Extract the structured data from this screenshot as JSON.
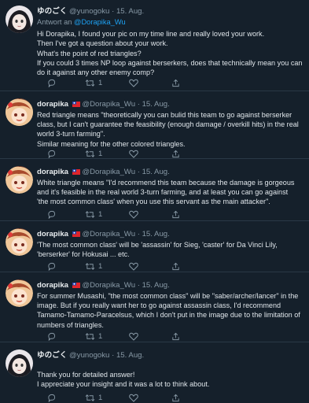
{
  "tweets": [
    {
      "avatar": "avatar-yunogoku",
      "name": "ゆのごく",
      "flag": false,
      "handle": "@yunogoku",
      "sep": "·",
      "date": "15. Aug.",
      "reply_prefix": "Antwort an ",
      "reply_mention": "@Dorapika_Wu",
      "lines": [
        "Hi Dorapika, I found your pic on my time line and really loved your work.",
        "Then I've got a question about your work.",
        "What's the point of red triangles?",
        "If you could 3 times NP loop against berserkers, does that technically mean you can",
        "do it against any other enemy comp?"
      ],
      "retweets": "1"
    },
    {
      "avatar": "avatar-dorapika",
      "name": "dorapika",
      "flag": true,
      "handle": "@Dorapika_Wu",
      "sep": "·",
      "date": "15. Aug.",
      "lines": [
        "Red triangle means \"theoretically you can bulid this team to go against berserker",
        "class, but I can't guarantee the feasibility (enough damage / overkill hits) in the real",
        "world 3-turn farming\".",
        "Similar meaning for the other colored triangles."
      ],
      "retweets": "1"
    },
    {
      "avatar": "avatar-dorapika",
      "name": "dorapika",
      "flag": true,
      "handle": "@Dorapika_Wu",
      "sep": "·",
      "date": "15. Aug.",
      "lines": [
        "White triangle means \"I'd recommend this team because the damage is gorgeous",
        "and it's feasible in the real world 3-turn farming, and at least you can go against",
        "'the most common class' when you use this servant as the main attacker\"."
      ],
      "retweets": "1"
    },
    {
      "avatar": "avatar-dorapika",
      "name": "dorapika",
      "flag": true,
      "handle": "@Dorapika_Wu",
      "sep": "·",
      "date": "15. Aug.",
      "lines": [
        "'The most common class' will be 'assassin' for Sieg, 'caster' for Da Vinci Lily,",
        "'berserker' for Hokusai ... etc."
      ],
      "retweets": "1"
    },
    {
      "avatar": "avatar-dorapika",
      "name": "dorapika",
      "flag": true,
      "handle": "@Dorapika_Wu",
      "sep": "·",
      "date": "15. Aug.",
      "lines": [
        "For summer Musashi, \"the most common class\" will be \"saber/archer/lancer\" in the",
        "image. But if you really want her to go against assassin class, I'd recommend",
        "Tamamo-Tamamo-Paracelsus, which I don't put in the image due to the limitation of",
        "numbers of triangles."
      ],
      "retweets": "1"
    },
    {
      "avatar": "avatar-yunogoku",
      "name": "ゆのごく",
      "flag": false,
      "handle": "@yunogoku",
      "sep": "·",
      "date": "15. Aug.",
      "lines": [
        "Thank you for detailed answer!",
        "I appreciate your insight and it was a lot to think about."
      ],
      "retweets": "1"
    }
  ],
  "colors": {
    "background": "#15202b",
    "text": "#dfe5ea",
    "muted": "#8899a6",
    "link": "#1da1f2",
    "divider": "#2a3846"
  },
  "icons": [
    "reply-icon",
    "retweet-icon",
    "like-icon",
    "share-icon",
    "taiwan-flag-icon"
  ]
}
